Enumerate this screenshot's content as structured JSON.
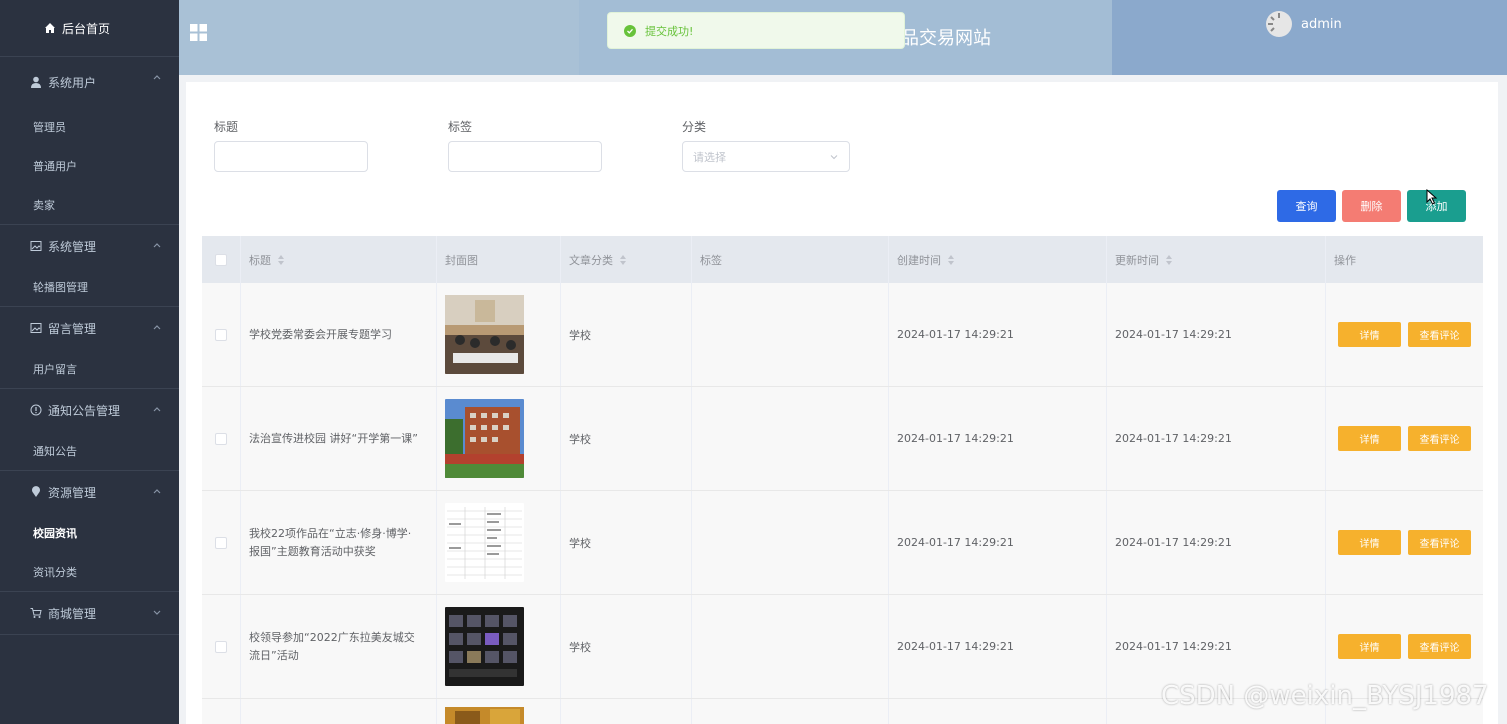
{
  "sidebar": {
    "home": "后台首页",
    "groups": [
      {
        "title": "系统用户",
        "items": [
          "管理员",
          "普通用户",
          "卖家"
        ]
      },
      {
        "title": "系统管理",
        "items": [
          "轮播图管理"
        ]
      },
      {
        "title": "留言管理",
        "items": [
          "用户留言"
        ]
      },
      {
        "title": "通知公告管理",
        "items": [
          "通知公告"
        ]
      },
      {
        "title": "资源管理",
        "items": [
          "校园资讯",
          "资讯分类"
        ]
      },
      {
        "title": "商城管理",
        "items": []
      }
    ]
  },
  "header": {
    "site_title": "品交易网站",
    "username": "admin"
  },
  "toast": {
    "message": "提交成功!"
  },
  "filters": {
    "title_label": "标题",
    "tag_label": "标签",
    "category_label": "分类",
    "category_placeholder": "请选择"
  },
  "actions": {
    "search": "查询",
    "delete": "删除",
    "add": "添加"
  },
  "table": {
    "headers": [
      "标题",
      "封面图",
      "文章分类",
      "标签",
      "创建时间",
      "更新时间",
      "操作"
    ],
    "rows": [
      {
        "title": "学校党委常委会开展专题学习",
        "category": "学校",
        "tag": "",
        "created": "2024-01-17 14:29:21",
        "updated": "2024-01-17 14:29:21"
      },
      {
        "title": "法治宣传进校园 讲好“开学第一课”",
        "category": "学校",
        "tag": "",
        "created": "2024-01-17 14:29:21",
        "updated": "2024-01-17 14:29:21"
      },
      {
        "title": "我校22项作品在“立志·修身·博学·报国”主题教育活动中获奖",
        "category": "学校",
        "tag": "",
        "created": "2024-01-17 14:29:21",
        "updated": "2024-01-17 14:29:21"
      },
      {
        "title": "校领导参加“2022广东拉美友城交流日”活动",
        "category": "学校",
        "tag": "",
        "created": "2024-01-17 14:29:21",
        "updated": "2024-01-17 14:29:21"
      }
    ],
    "row_detail": "详情",
    "row_comments": "查看评论"
  },
  "watermark": "CSDN @weixin_BYSJ1987"
}
